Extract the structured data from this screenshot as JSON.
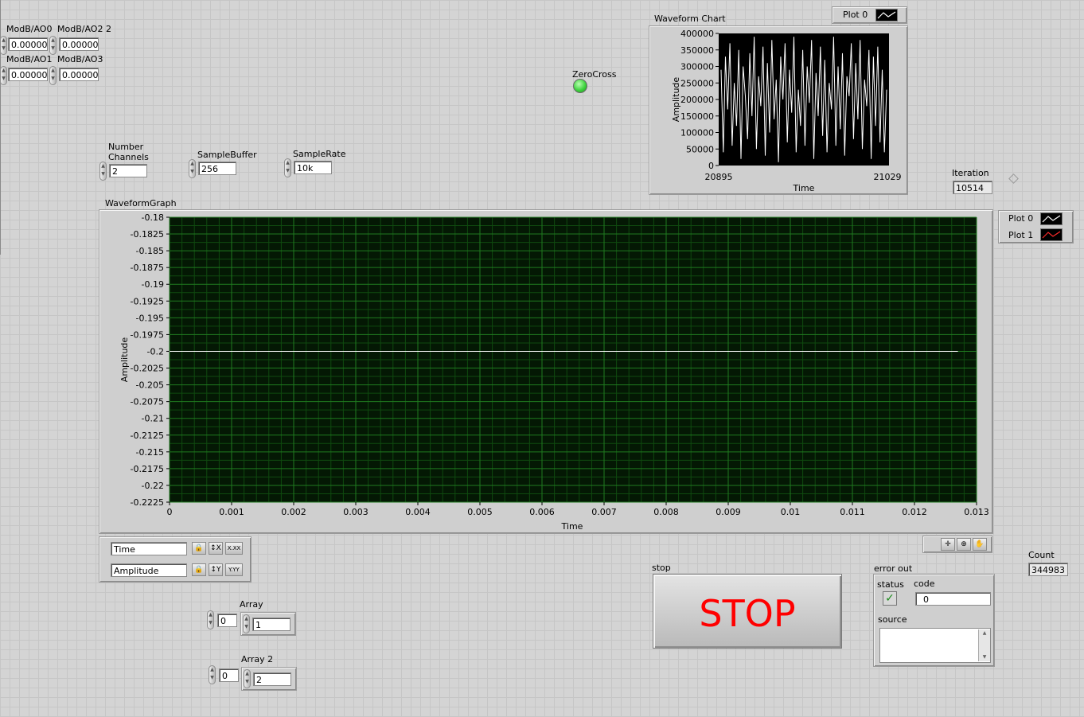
{
  "controls": {
    "ao0": {
      "label": "ModB/AO0",
      "value": "0.000000"
    },
    "ao2": {
      "label": "ModB/AO2 2",
      "value": "0.000000"
    },
    "ao1": {
      "label": "ModB/AO1",
      "value": "0.000000"
    },
    "ao3": {
      "label": "ModB/AO3",
      "value": "0.000000"
    },
    "number_channels": {
      "label_line1": "Number",
      "label_line2": "Channels",
      "value": "2"
    },
    "sample_buffer": {
      "label": "SampleBuffer",
      "value": "256"
    },
    "sample_rate": {
      "label": "SampleRate",
      "value": "10k"
    }
  },
  "zerocross": {
    "label": "ZeroCross",
    "color": "#3fd33f"
  },
  "iteration": {
    "label": "Iteration",
    "value": "10514"
  },
  "count": {
    "label": "Count",
    "value": "344983"
  },
  "waveform_chart": {
    "title": "Waveform Chart",
    "legend": "Plot 0",
    "ylabel": "Amplitude",
    "xlabel": "Time",
    "yticks": [
      "400000",
      "350000",
      "300000",
      "250000",
      "200000",
      "150000",
      "100000",
      "50000",
      "0"
    ],
    "xmin_label": "20895",
    "xmax_label": "21029"
  },
  "waveform_graph": {
    "title": "WaveformGraph",
    "ylabel": "Amplitude",
    "xlabel": "Time",
    "legend": [
      "Plot 0",
      "Plot 1"
    ],
    "legend_colors": [
      "#ffffff",
      "#ff2a2a"
    ],
    "yticks": [
      "-0.18",
      "-0.1825",
      "-0.185",
      "-0.1875",
      "-0.19",
      "-0.1925",
      "-0.195",
      "-0.1975",
      "-0.2",
      "-0.2025",
      "-0.205",
      "-0.2075",
      "-0.21",
      "-0.2125",
      "-0.215",
      "-0.2175",
      "-0.22",
      "-0.2225"
    ],
    "xticks": [
      "0",
      "0.001",
      "0.002",
      "0.003",
      "0.004",
      "0.005",
      "0.006",
      "0.007",
      "0.008",
      "0.009",
      "0.01",
      "0.011",
      "0.012",
      "0.013"
    ],
    "scale_legend": {
      "x_name": "Time",
      "y_name": "Amplitude",
      "x_fmt_label": "X.XX",
      "y_fmt_label": "Y.YY"
    }
  },
  "chart_data": [
    {
      "type": "line",
      "title": "Waveform Chart",
      "xlabel": "Time",
      "ylabel": "Amplitude",
      "xlim": [
        20895,
        21029
      ],
      "ylim": [
        0,
        400000
      ],
      "series": [
        {
          "name": "Plot 0",
          "color": "#ffffff",
          "values": [
            290000,
            40000,
            330000,
            170000,
            370000,
            60000,
            250000,
            120000,
            350000,
            20000,
            300000,
            210000,
            80000,
            340000,
            150000,
            390000,
            50000,
            270000,
            180000,
            360000,
            30000,
            310000,
            100000,
            380000,
            140000,
            260000,
            10000,
            330000,
            200000,
            370000,
            70000,
            290000,
            160000,
            390000,
            40000,
            230000,
            120000,
            350000,
            60000,
            300000,
            190000,
            380000,
            20000,
            280000,
            150000,
            360000,
            90000,
            320000,
            40000,
            250000,
            170000,
            390000,
            60000,
            300000,
            110000,
            340000,
            30000,
            270000,
            210000,
            370000,
            80000,
            310000,
            140000,
            380000,
            50000,
            260000,
            180000,
            350000,
            20000,
            330000,
            120000,
            360000,
            70000,
            290000,
            40000,
            230000
          ]
        }
      ]
    },
    {
      "type": "line",
      "title": "WaveformGraph",
      "xlabel": "Time",
      "ylabel": "Amplitude",
      "xlim": [
        0,
        0.013
      ],
      "ylim": [
        -0.2225,
        -0.18
      ],
      "series": [
        {
          "name": "Plot 0",
          "color": "#ffffff",
          "x": [
            0,
            0.0127
          ],
          "values": [
            -0.2,
            -0.2
          ]
        }
      ]
    }
  ],
  "stop": {
    "label": "stop",
    "button_text": "STOP"
  },
  "error_out": {
    "label": "error out",
    "status_label": "status",
    "code_label": "code",
    "code_value": "0",
    "source_label": "source",
    "source_value": ""
  },
  "array1": {
    "label": "Array",
    "index": "0",
    "value": "1"
  },
  "array2": {
    "label": "Array 2",
    "index": "0",
    "value": "2"
  }
}
